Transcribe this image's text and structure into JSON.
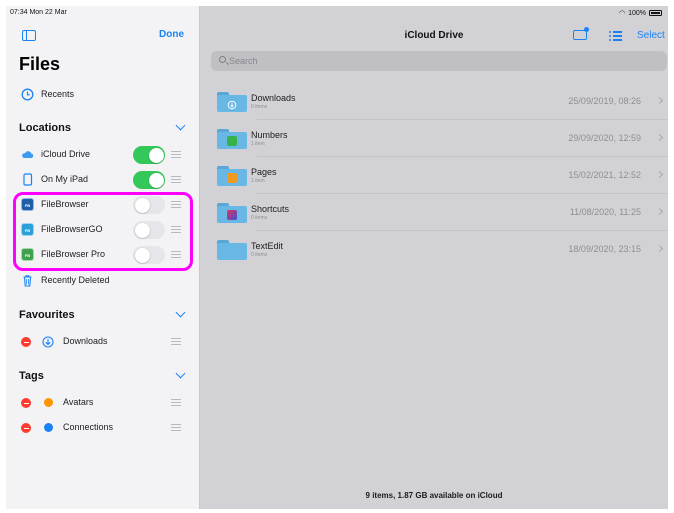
{
  "status_bar": {
    "time": "07:34  Mon 22 Mar",
    "battery": "100%"
  },
  "sidebar": {
    "done_label": "Done",
    "title": "Files",
    "recents_label": "Recents",
    "locations_header": "Locations",
    "locations": [
      {
        "label": "iCloud Drive",
        "enabled": true
      },
      {
        "label": "On My iPad",
        "enabled": true
      },
      {
        "label": "FileBrowser",
        "enabled": false,
        "icon_text": "FB"
      },
      {
        "label": "FileBrowserGO",
        "enabled": false,
        "icon_text": "FB"
      },
      {
        "label": "FileBrowser Pro",
        "enabled": false,
        "icon_text": "FB"
      }
    ],
    "recently_deleted_label": "Recently Deleted",
    "favourites_header": "Favourites",
    "favourites": [
      {
        "label": "Downloads"
      }
    ],
    "tags_header": "Tags",
    "tags": [
      {
        "label": "Avatars",
        "color": "#ff9500"
      },
      {
        "label": "Connections",
        "color": "#1a82f7"
      }
    ],
    "highlight_color": "#ff00ff"
  },
  "main": {
    "title": "iCloud Drive",
    "select_label": "Select",
    "search_placeholder": "Search",
    "folders": [
      {
        "name": "Downloads",
        "count": "0 items",
        "date": "25/09/2019, 08:26",
        "icon": "downloads-badge-icon"
      },
      {
        "name": "Numbers",
        "count": "1 item",
        "date": "29/09/2020, 12:59",
        "icon": "numbers-app-icon"
      },
      {
        "name": "Pages",
        "count": "1 item",
        "date": "15/02/2021, 12:52",
        "icon": "pages-app-icon"
      },
      {
        "name": "Shortcuts",
        "count": "0 items",
        "date": "11/08/2020, 11:25",
        "icon": "shortcuts-app-icon"
      },
      {
        "name": "TextEdit",
        "count": "0 items",
        "date": "18/09/2020, 23:15",
        "icon": ""
      }
    ],
    "footer": "9 items, 1.87 GB available on iCloud"
  },
  "colors": {
    "accent": "#1a82f7",
    "toggle_on": "#34c759",
    "delete": "#ff3b30"
  }
}
